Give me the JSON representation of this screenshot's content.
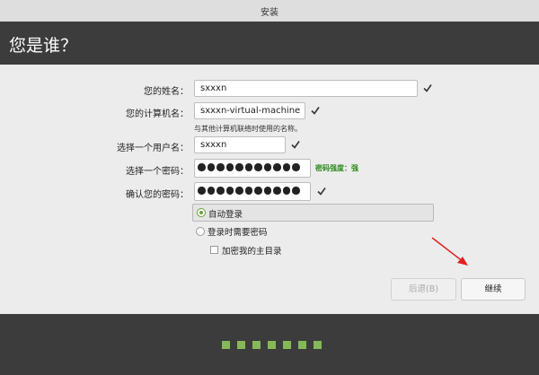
{
  "window": {
    "title": "安装"
  },
  "header": {
    "title": "您是谁？"
  },
  "form": {
    "name": {
      "label": "您的姓名：",
      "value": "sxxxn"
    },
    "computer": {
      "label": "您的计算机名：",
      "value": "sxxxn-virtual-machine",
      "hint": "与其他计算机联络时使用的名称。"
    },
    "username": {
      "label": "选择一个用户名：",
      "value": "sxxxn"
    },
    "password": {
      "label": "选择一个密码：",
      "strength": "密码强度：强"
    },
    "confirm": {
      "label": "确认您的密码："
    }
  },
  "login_options": {
    "auto_login": "自动登录",
    "require_password": "登录时需要密码",
    "encrypt_home": "加密我的主目录"
  },
  "buttons": {
    "back": "后退(B)",
    "continue": "继续"
  },
  "colors": {
    "accent": "#86b85a",
    "header_bg": "#3c3c3c",
    "strength": "#2a8a1a"
  },
  "progress": {
    "total_steps": 7
  }
}
